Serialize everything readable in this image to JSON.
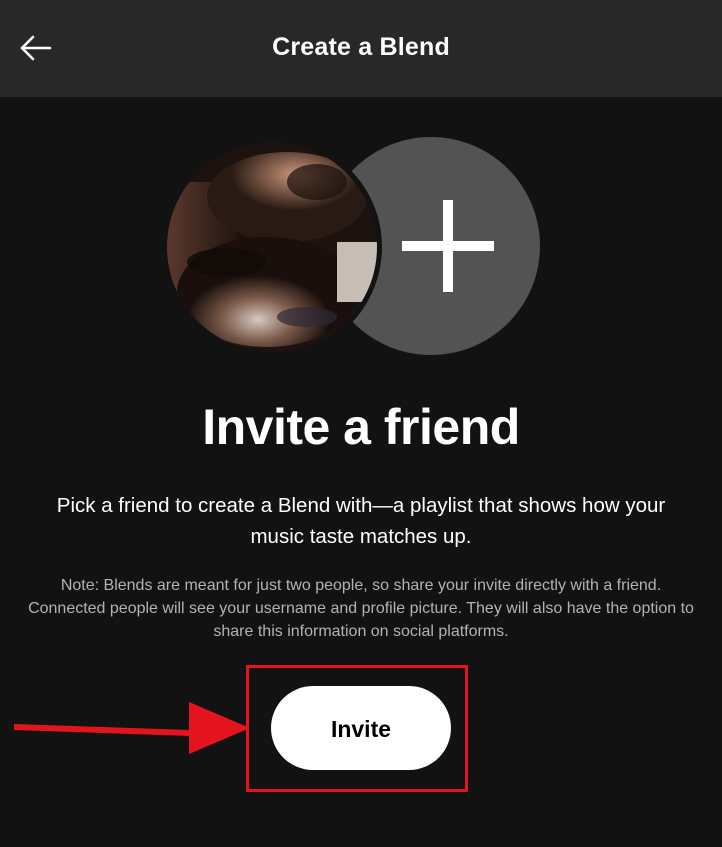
{
  "header": {
    "title": "Create a Blend",
    "back_icon": "arrow-left-icon"
  },
  "main": {
    "heading": "Invite a friend",
    "description": "Pick a friend to create a Blend with—a playlist that shows how your music taste matches up.",
    "note": "Note: Blends are meant for just two people, so share your invite directly with a friend. Connected people will see your username and profile picture. They will also have the option to share this information on social platforms.",
    "invite_label": "Invite",
    "add_icon": "plus-icon"
  },
  "annotation": {
    "arrow_color": "#e4141e",
    "box_color": "#e4141e"
  },
  "colors": {
    "background": "#121212",
    "header_bg": "#282828",
    "plus_circle": "#535353",
    "note_text": "#b3b3b3",
    "button_bg": "#ffffff"
  }
}
